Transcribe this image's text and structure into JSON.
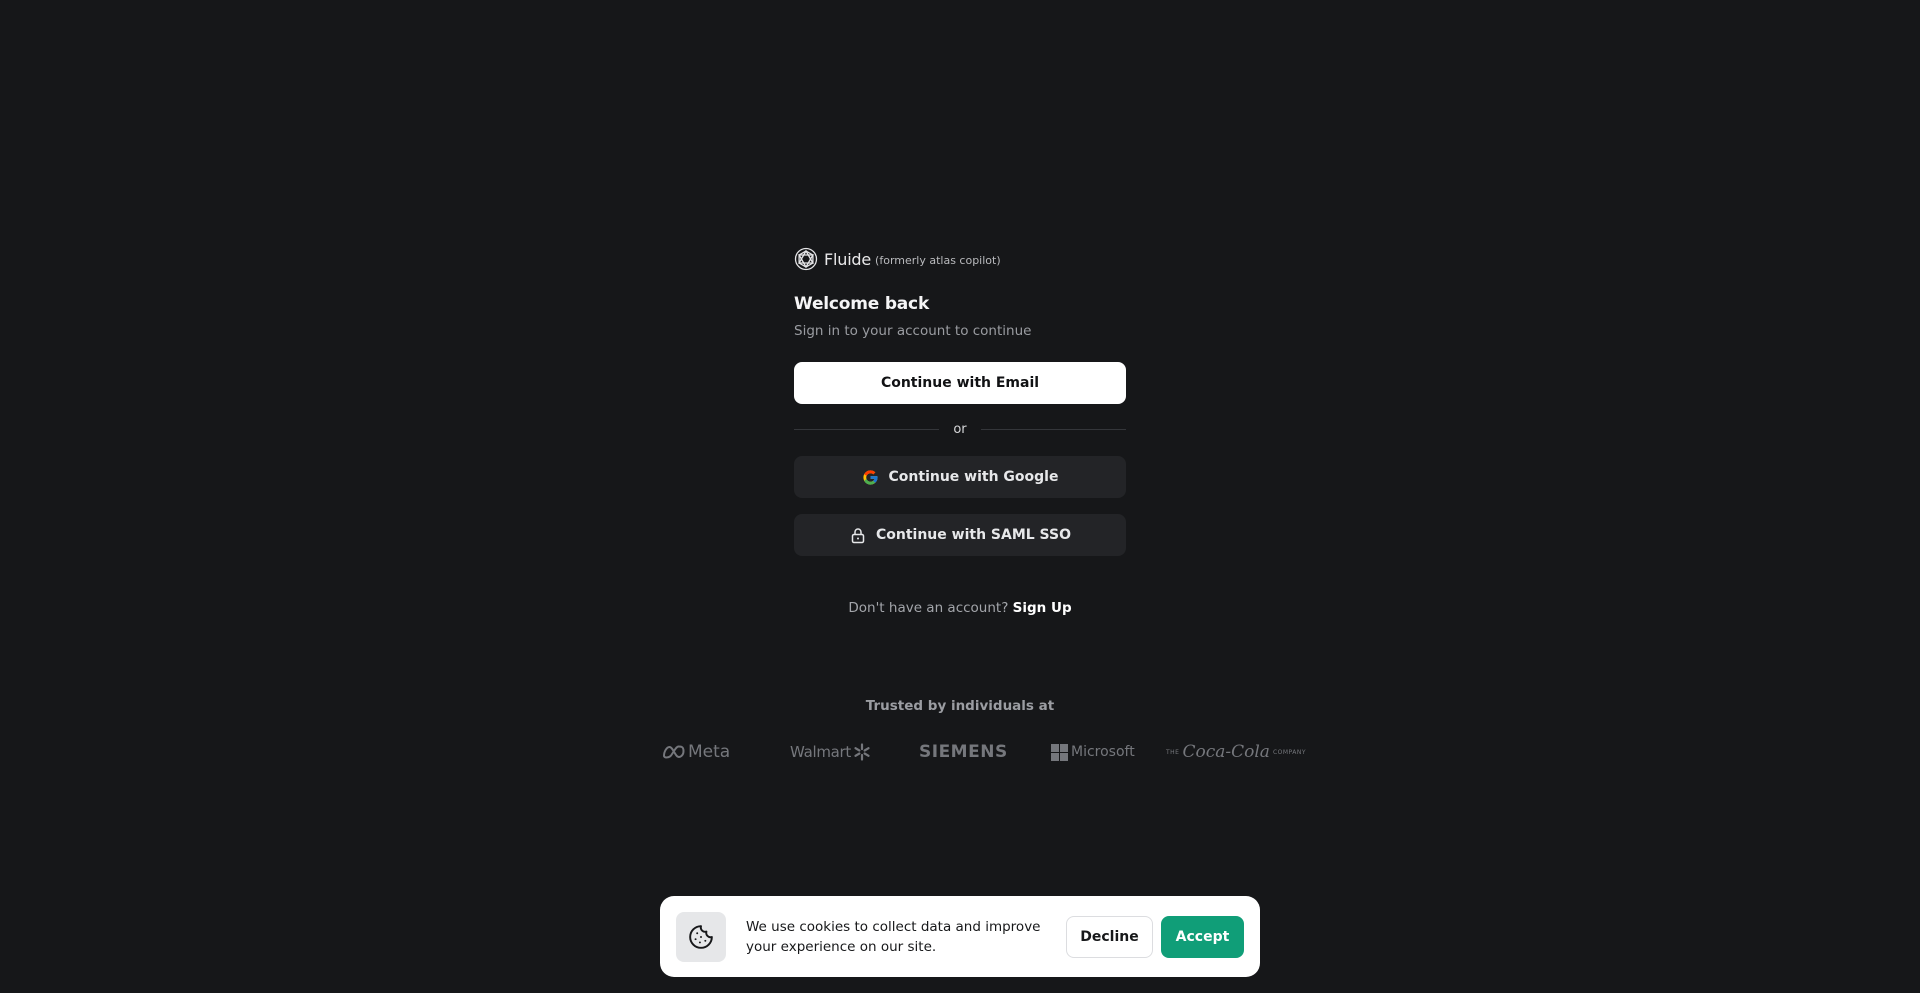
{
  "brand": {
    "name": "Fluide",
    "subtitle": "(formerly atlas copilot)"
  },
  "header": {
    "title": "Welcome back",
    "subtitle": "Sign in to your account to continue"
  },
  "auth": {
    "email_label": "Continue with Email",
    "divider_label": "or",
    "google_label": "Continue with Google",
    "saml_label": "Continue with SAML SSO"
  },
  "signup": {
    "prompt": "Don't have an account?",
    "link_label": "Sign Up"
  },
  "trusted": {
    "heading": "Trusted by individuals at",
    "logos": [
      "Meta",
      "Walmart",
      "SIEMENS",
      "Microsoft",
      "Coca-Cola"
    ],
    "coke_prefix": "THE",
    "coke_suffix": "COMPANY"
  },
  "cookie_banner": {
    "message": "We use cookies to collect data and improve your experience on our site.",
    "decline_label": "Decline",
    "accept_label": "Accept",
    "icon": "cookie-icon"
  },
  "colors": {
    "background": "#161719",
    "accent": "#109e78",
    "button_dark": "#232427"
  }
}
